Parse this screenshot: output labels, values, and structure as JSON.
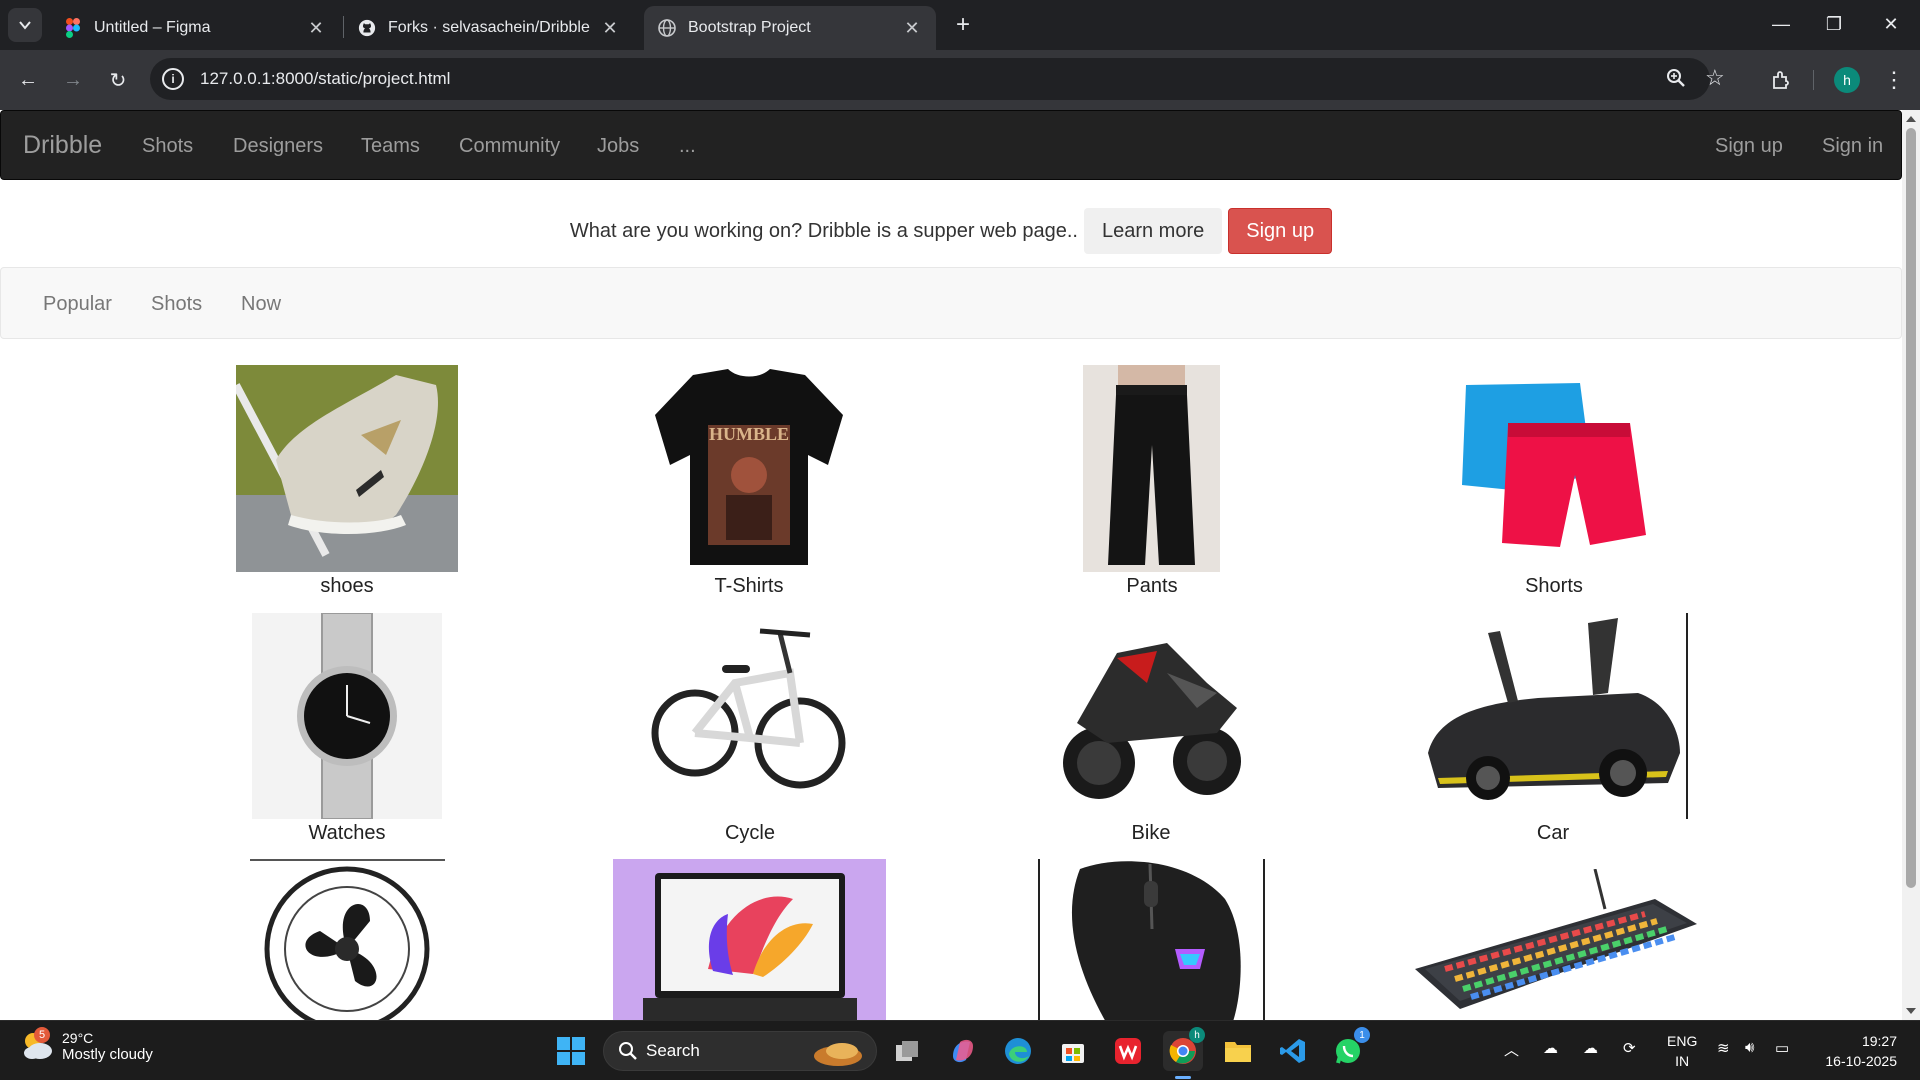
{
  "browser": {
    "tabs": [
      {
        "title": "Untitled – Figma",
        "favicon": "figma-icon",
        "active": false
      },
      {
        "title": "Forks · selvasachein/Dribble",
        "favicon": "github-icon",
        "active": false
      },
      {
        "title": "Bootstrap Project",
        "favicon": "globe-icon",
        "active": true
      }
    ],
    "url": "127.0.0.1:8000/static/project.html",
    "profile_initial": "h"
  },
  "site": {
    "brand": "Dribble",
    "nav_left": [
      "Shots",
      "Designers",
      "Teams",
      "Community",
      "Jobs",
      "..."
    ],
    "nav_right": [
      "Sign up",
      "Sign in"
    ],
    "promo_text": "What are you working on? Dribble is a supper web page..",
    "learn_more": "Learn more",
    "signup_button": "Sign up",
    "subnav": [
      "Popular",
      "Shots",
      "Now"
    ],
    "products": [
      {
        "caption": "shoes"
      },
      {
        "caption": "T-Shirts"
      },
      {
        "caption": "Pants"
      },
      {
        "caption": "Shorts"
      },
      {
        "caption": "Watches"
      },
      {
        "caption": "Cycle"
      },
      {
        "caption": "Bike"
      },
      {
        "caption": "Car"
      },
      {
        "caption": ""
      },
      {
        "caption": ""
      },
      {
        "caption": ""
      },
      {
        "caption": ""
      }
    ],
    "tshirt_print": "HUMBLE"
  },
  "taskbar": {
    "weather_temp": "29°C",
    "weather_cond": "Mostly cloudy",
    "weather_badge": "5",
    "search_label": "Search",
    "whatsapp_badge": "1",
    "chrome_badge": "h",
    "lang_top": "ENG",
    "lang_bottom": "IN",
    "time": "19:27",
    "date": "16-10-2025"
  }
}
